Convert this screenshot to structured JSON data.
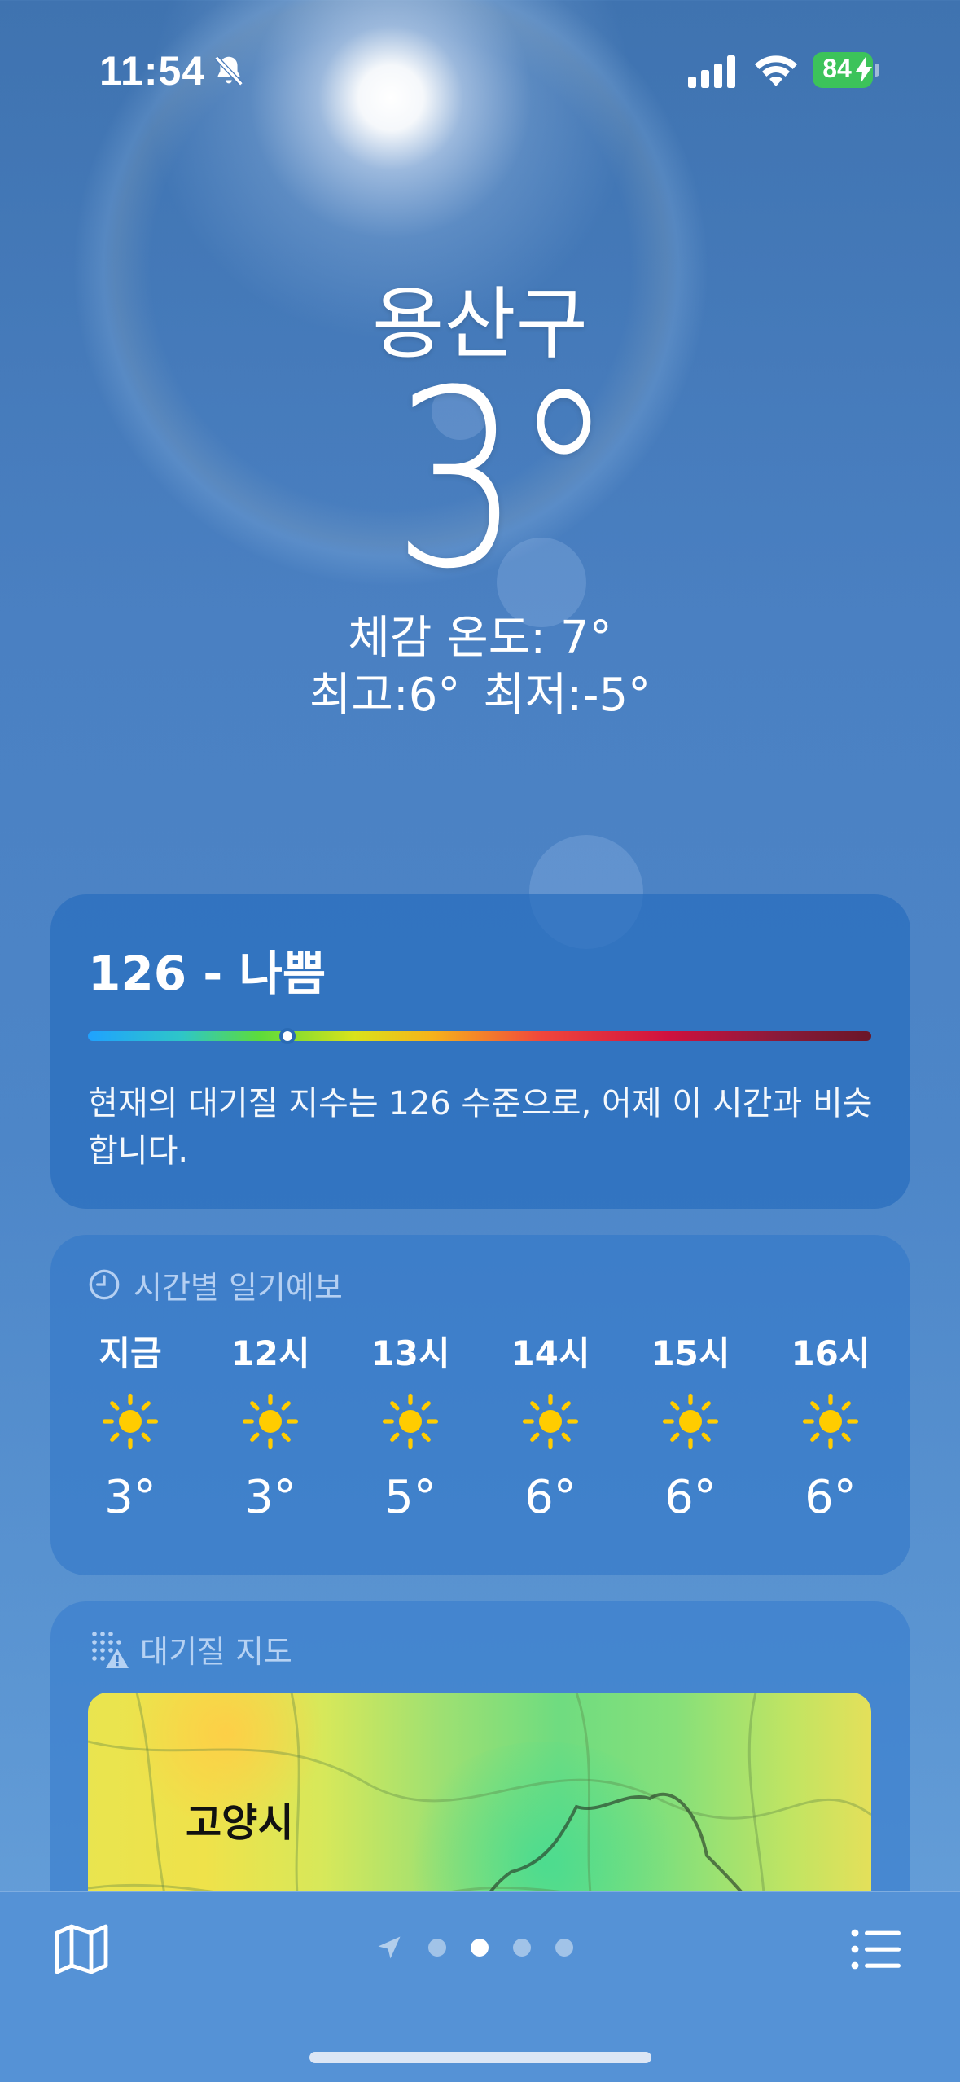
{
  "status_bar": {
    "time": "11:54",
    "battery": "84",
    "icons": [
      "bell-slash-icon",
      "cellular-signal-icon",
      "wifi-icon",
      "battery-charging-icon"
    ]
  },
  "hero": {
    "city": "용산구",
    "temperature": "3°",
    "feels_like": "체감 온도: 7°",
    "high": "최고:6°",
    "low": "최저:-5°"
  },
  "air_quality": {
    "title": "126 - 나쁨",
    "index": 126,
    "level_fraction": 0.255,
    "description": "현재의 대기질 지수는 126 수준으로, 어제 이 시간과 비슷합니다."
  },
  "hourly": {
    "header": "시간별 일기예보",
    "icon": "clock-icon",
    "items": [
      {
        "label": "지금",
        "icon": "sun-icon",
        "temp": "3°"
      },
      {
        "label": "12시",
        "icon": "sun-icon",
        "temp": "3°"
      },
      {
        "label": "13시",
        "icon": "sun-icon",
        "temp": "5°"
      },
      {
        "label": "14시",
        "icon": "sun-icon",
        "temp": "6°"
      },
      {
        "label": "15시",
        "icon": "sun-icon",
        "temp": "6°"
      },
      {
        "label": "16시",
        "icon": "sun-icon",
        "temp": "6°"
      }
    ]
  },
  "air_map": {
    "header": "대기질 지도",
    "icon": "air-quality-warning-icon",
    "city_label": "고양시"
  },
  "bottom_bar": {
    "pages": 4,
    "active_page": 2,
    "icons": [
      "map-icon",
      "location-arrow-icon",
      "list-icon"
    ]
  },
  "colors": {
    "sun": "#ffcc00",
    "battery": "#3cc35a"
  }
}
